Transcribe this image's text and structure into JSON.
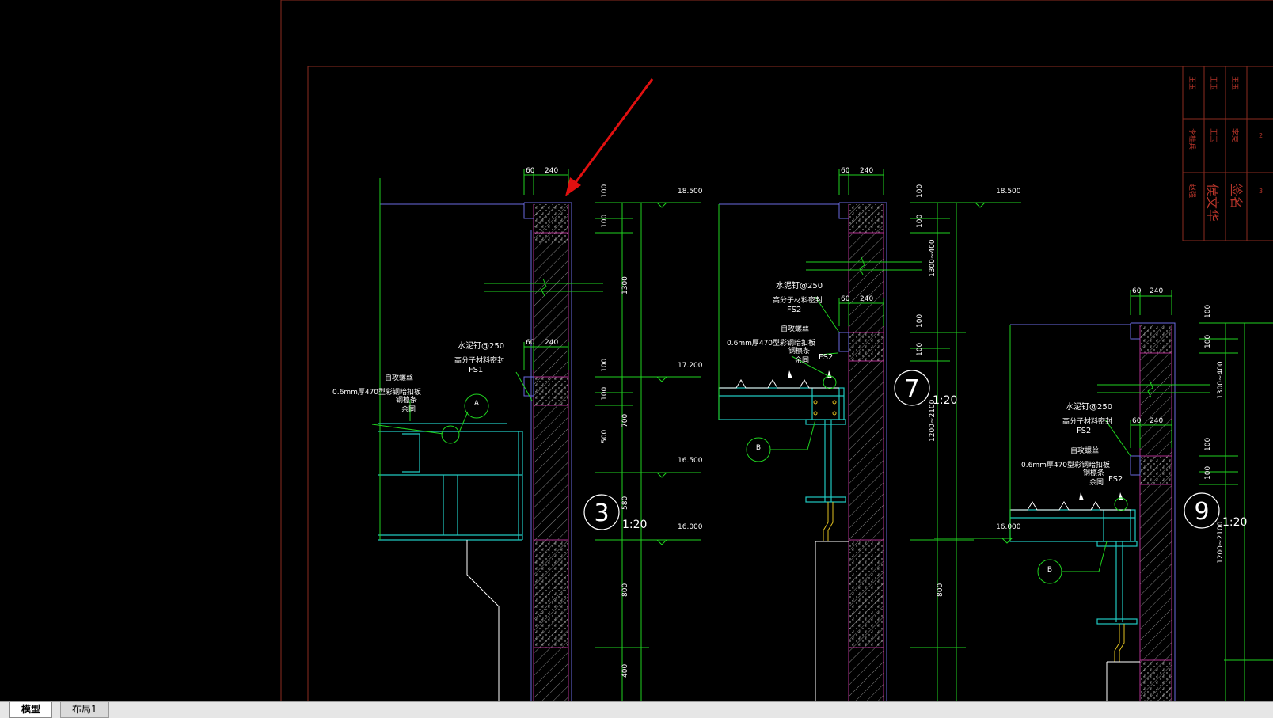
{
  "tabs": [
    {
      "label": "模型",
      "active": true
    },
    {
      "label": "布局1",
      "active": false
    }
  ],
  "colors": {
    "background": "#000000",
    "frame": "#8b2b1f",
    "green": "#1fd21f",
    "wall": "#b0308f",
    "steel": "#20c8c0",
    "white": "#ffffff",
    "annotation_arrow": "#e01010",
    "tab_bar": "#e6e6e6"
  },
  "title_block": {
    "cells": [
      "李桂兵",
      "王玉",
      "李克",
      "赵强",
      "侯文华",
      "签名",
      "2",
      "3"
    ]
  },
  "detail_3": {
    "dims_top": [
      "60",
      "240"
    ],
    "dims_mid": [
      "60",
      "240"
    ],
    "elev_labels": [
      "18.500",
      "17.200",
      "16.500",
      "16.000"
    ],
    "vert_dims": [
      "100",
      "100",
      "1300",
      "100",
      "100",
      "700",
      "500",
      "580",
      "800",
      "400"
    ],
    "notes": [
      "水泥钉@250",
      "高分子材料密封",
      "FS1",
      "自攻螺丝",
      "0.6mm厚470型彩钢暗扣板",
      "钢檩条",
      "余同"
    ],
    "bubble_a": "A",
    "number": "3",
    "scale": "1:20"
  },
  "detail_7": {
    "dims_top": [
      "60",
      "240"
    ],
    "dims_mid": [
      "60",
      "240"
    ],
    "elev_labels": [
      "18.500"
    ],
    "vert_dims": [
      "100",
      "100",
      "1300~400",
      "100",
      "100",
      "1200~2100",
      "800"
    ],
    "notes": [
      "水泥钉@250",
      "高分子材料密封",
      "FS2",
      "自攻螺丝",
      "0.6mm厚470型彩钢暗扣板",
      "钢檩条",
      "余同",
      "FS2"
    ],
    "bubble_b": "B",
    "number": "7",
    "scale": "1:20"
  },
  "detail_9": {
    "dims_top": [
      "60",
      "240"
    ],
    "dims_mid": [
      "60",
      "240"
    ],
    "elev_labels": [
      "16.000"
    ],
    "vert_dims": [
      "100",
      "100",
      "1300~400",
      "100",
      "100",
      "1200~2100"
    ],
    "notes": [
      "水泥钉@250",
      "高分子材料密封",
      "FS2",
      "自攻螺丝",
      "0.6mm厚470型彩钢暗扣板",
      "钢檩条",
      "余同",
      "FS2"
    ],
    "bubble_b": "B",
    "number": "9",
    "scale": "1:20"
  }
}
